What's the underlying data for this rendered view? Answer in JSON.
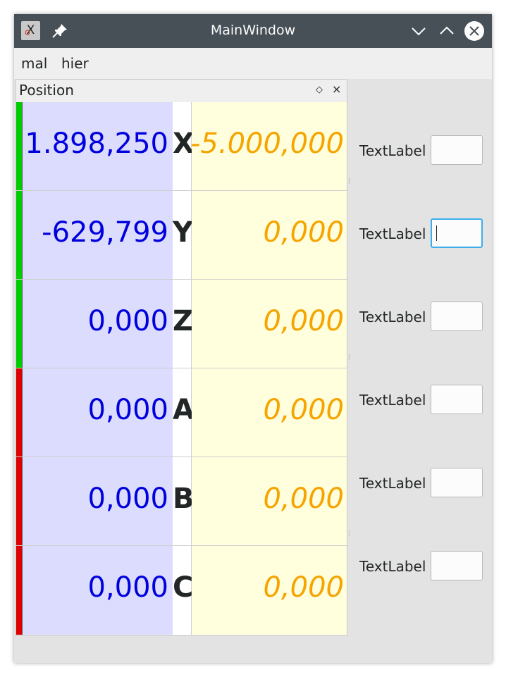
{
  "window": {
    "title": "MainWindow",
    "colors": {
      "titlebar": "#475057",
      "actual_bg": "#dcdcff",
      "actual_text": "#0000dd",
      "target_bg": "#ffffdd",
      "target_text": "#f5a400",
      "ok": "#00cc00",
      "error": "#dd0000"
    }
  },
  "titlebar": {
    "app_icon": "kdevelop-app-icon",
    "pin_icon": "pin-icon",
    "minimize_icon": "chevron-down-icon",
    "maximize_icon": "chevron-up-icon",
    "close_icon": "close-circle-icon"
  },
  "menu": {
    "items": [
      {
        "label": "mal"
      },
      {
        "label": "hier"
      }
    ]
  },
  "dock": {
    "title": "Position",
    "float_icon": "float-icon",
    "close_label": "×",
    "rows": [
      {
        "axis": "X",
        "actual": "1.898,250",
        "target": "-5.000,000",
        "status": "ok"
      },
      {
        "axis": "Y",
        "actual": "-629,799",
        "target": "0,000",
        "status": "ok"
      },
      {
        "axis": "Z",
        "actual": "0,000",
        "target": "0,000",
        "status": "ok"
      },
      {
        "axis": "A",
        "actual": "0,000",
        "target": "0,000",
        "status": "error"
      },
      {
        "axis": "B",
        "actual": "0,000",
        "target": "0,000",
        "status": "error"
      },
      {
        "axis": "C",
        "actual": "0,000",
        "target": "0,000",
        "status": "error"
      }
    ]
  },
  "side_fields": [
    {
      "label": "TextLabel",
      "value": ""
    },
    {
      "label": "TextLabel",
      "value": "",
      "focused": true
    },
    {
      "label": "TextLabel",
      "value": ""
    },
    {
      "label": "TextLabel",
      "value": ""
    },
    {
      "label": "TextLabel",
      "value": ""
    },
    {
      "label": "TextLabel",
      "value": ""
    }
  ]
}
